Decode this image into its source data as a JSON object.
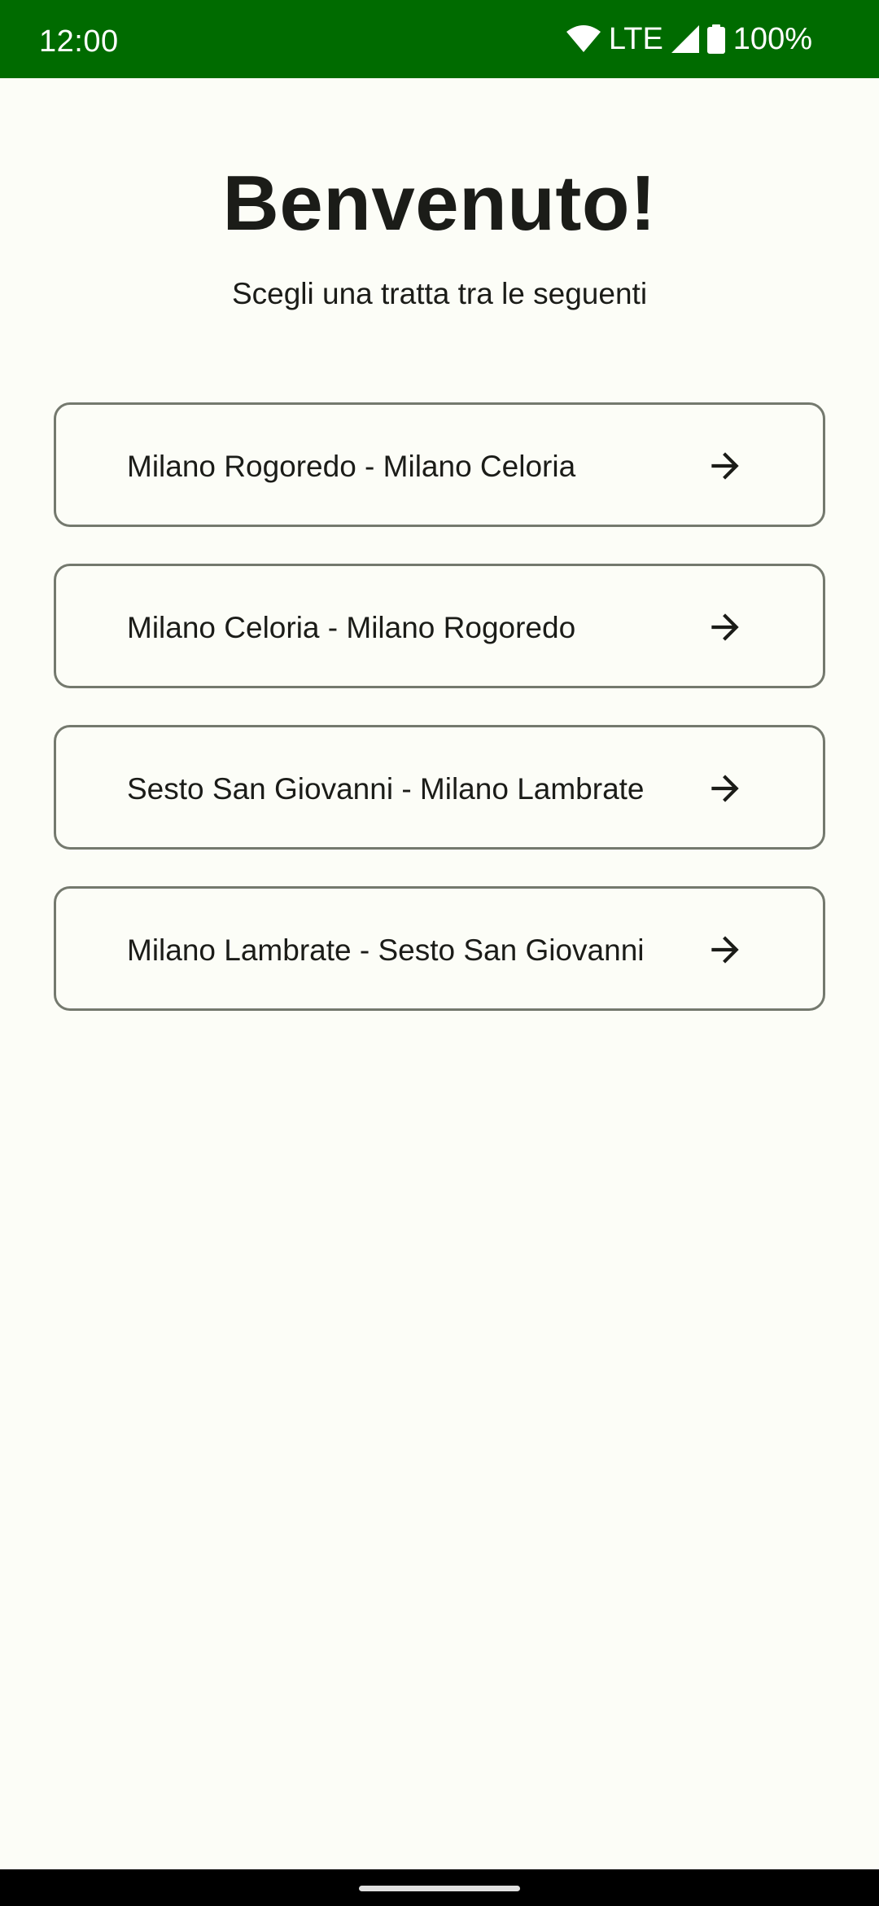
{
  "status_bar": {
    "time": "12:00",
    "network": "LTE",
    "battery": "100%",
    "background_color": "#006B00",
    "icons": [
      "wifi-icon",
      "signal-icon",
      "battery-icon"
    ]
  },
  "header": {
    "title": "Benvenuto!",
    "subtitle": "Scegli una tratta tra le seguenti"
  },
  "routes": [
    {
      "label": "Milano Rogoredo - Milano Celoria",
      "icon": "arrow-right-icon"
    },
    {
      "label": "Milano Celoria - Milano Rogoredo",
      "icon": "arrow-right-icon"
    },
    {
      "label": "Sesto San Giovanni - Milano Lambrate",
      "icon": "arrow-right-icon"
    },
    {
      "label": "Milano Lambrate - Sesto San Giovanni",
      "icon": "arrow-right-icon"
    }
  ],
  "colors": {
    "page_background": "#FCFDF7",
    "text": "#1B1C18",
    "card_border": "#74796E"
  }
}
